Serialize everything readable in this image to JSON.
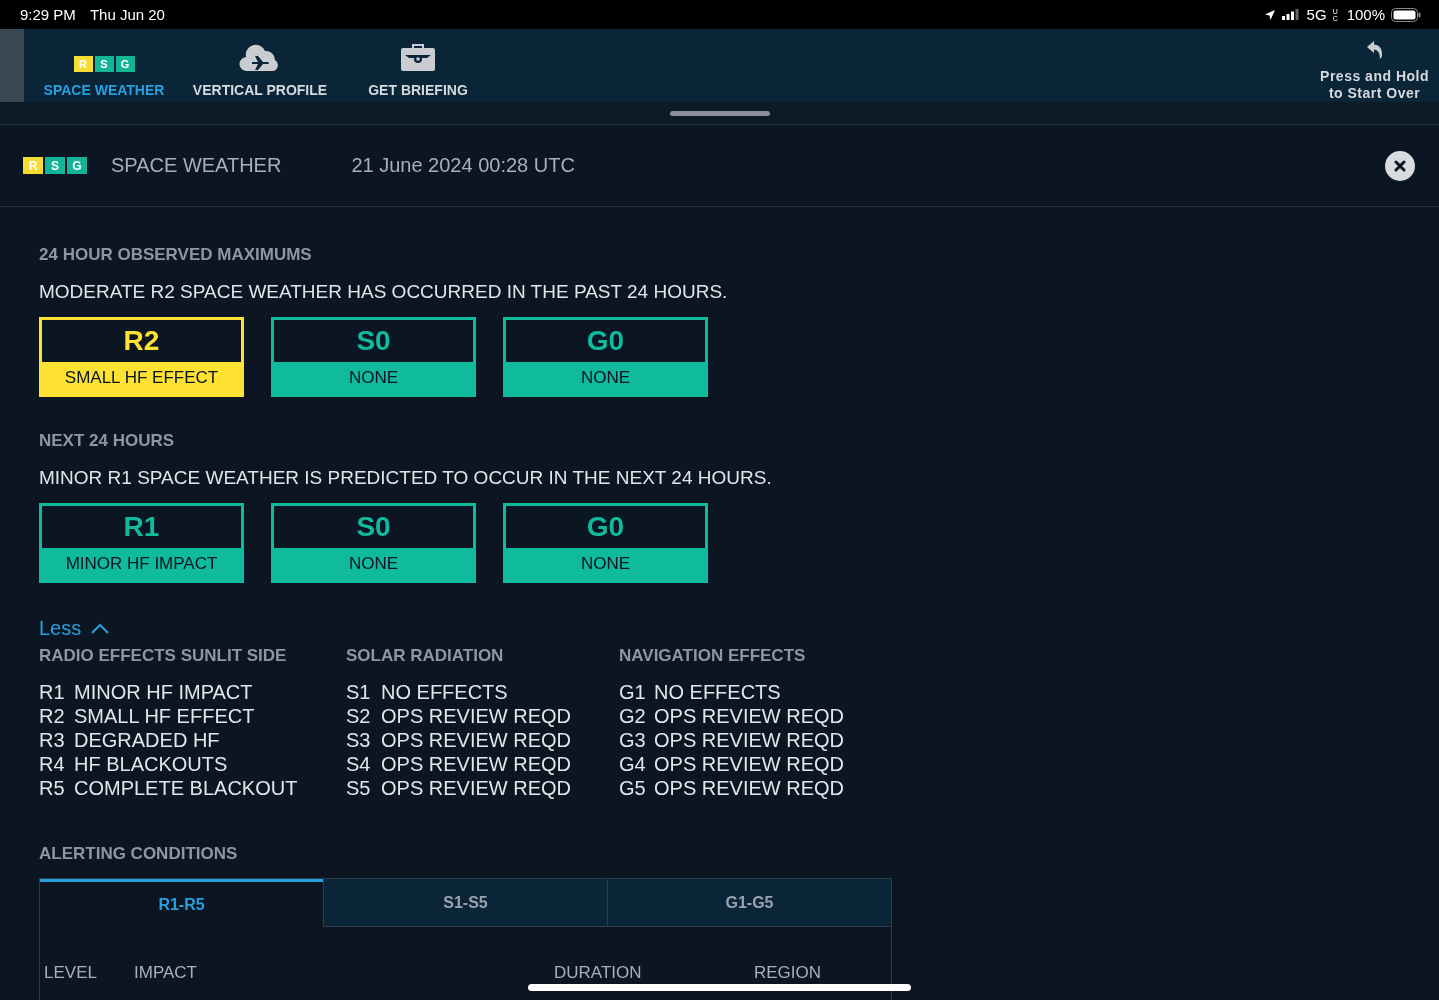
{
  "status_bar": {
    "time": "9:29 PM",
    "date": "Thu Jun 20",
    "network": "5G",
    "network_sub": "UC",
    "battery": "100%"
  },
  "nav": {
    "items": [
      {
        "label": "SPACE WEATHER",
        "kind": "logo",
        "selected": true
      },
      {
        "label": "VERTICAL PROFILE",
        "kind": "profile",
        "selected": false
      },
      {
        "label": "GET BRIEFING",
        "kind": "briefing",
        "selected": false
      }
    ],
    "start_over": {
      "line1": "Press and Hold",
      "line2": "to Start Over"
    }
  },
  "logo": [
    {
      "letter": "R",
      "color": "#f5dd33"
    },
    {
      "letter": "S",
      "color": "#14b596"
    },
    {
      "letter": "G",
      "color": "#14b596"
    }
  ],
  "header": {
    "logo": [
      {
        "letter": "R",
        "color": "#f5dd33"
      },
      {
        "letter": "S",
        "color": "#14b596"
      },
      {
        "letter": "G",
        "color": "#14b596"
      }
    ],
    "title": "SPACE WEATHER",
    "timestamp": "21 June 2024 00:28 UTC"
  },
  "sections": [
    {
      "heading": "24 HOUR OBSERVED MAXIMUMS",
      "summary": "MODERATE R2 SPACE WEATHER HAS OCCURRED IN THE PAST 24 HOURS.",
      "cards": [
        {
          "scale": "R2",
          "effect": "SMALL HF EFFECT",
          "color": "#fde234"
        },
        {
          "scale": "S0",
          "effect": "NONE",
          "color": "#10bb9d"
        },
        {
          "scale": "G0",
          "effect": "NONE",
          "color": "#10bb9d"
        }
      ]
    },
    {
      "heading": "NEXT 24 HOURS",
      "summary": "MINOR R1 SPACE WEATHER IS PREDICTED TO OCCUR IN THE NEXT 24 HOURS.",
      "cards": [
        {
          "scale": "R1",
          "effect": "MINOR HF IMPACT",
          "color": "#10bb9d"
        },
        {
          "scale": "S0",
          "effect": "NONE",
          "color": "#10bb9d"
        },
        {
          "scale": "G0",
          "effect": "NONE",
          "color": "#10bb9d"
        }
      ]
    }
  ],
  "legend": {
    "toggle": "Less",
    "expanded": true,
    "columns": [
      {
        "heading": "RADIO EFFECTS SUNLIT SIDE",
        "rows": [
          {
            "code": "R1",
            "text": "MINOR HF IMPACT"
          },
          {
            "code": "R2",
            "text": "SMALL HF EFFECT"
          },
          {
            "code": "R3",
            "text": "DEGRADED HF"
          },
          {
            "code": "R4",
            "text": "HF BLACKOUTS"
          },
          {
            "code": "R5",
            "text": "COMPLETE BLACKOUT"
          }
        ]
      },
      {
        "heading": "SOLAR RADIATION",
        "rows": [
          {
            "code": "S1",
            "text": "NO EFFECTS"
          },
          {
            "code": "S2",
            "text": "OPS REVIEW REQD"
          },
          {
            "code": "S3",
            "text": "OPS REVIEW REQD"
          },
          {
            "code": "S4",
            "text": "OPS REVIEW REQD"
          },
          {
            "code": "S5",
            "text": "OPS REVIEW REQD"
          }
        ]
      },
      {
        "heading": "NAVIGATION EFFECTS",
        "rows": [
          {
            "code": "G1",
            "text": "NO EFFECTS"
          },
          {
            "code": "G2",
            "text": "OPS REVIEW REQD"
          },
          {
            "code": "G3",
            "text": "OPS REVIEW REQD"
          },
          {
            "code": "G4",
            "text": "OPS REVIEW REQD"
          },
          {
            "code": "G5",
            "text": "OPS REVIEW REQD"
          }
        ]
      }
    ]
  },
  "alerting": {
    "heading": "ALERTING CONDITIONS",
    "tabs": [
      {
        "label": "R1-R5",
        "selected": true
      },
      {
        "label": "S1-S5",
        "selected": false
      },
      {
        "label": "G1-G5",
        "selected": false
      }
    ],
    "columns": [
      "LEVEL",
      "IMPACT",
      "DURATION",
      "REGION"
    ]
  }
}
